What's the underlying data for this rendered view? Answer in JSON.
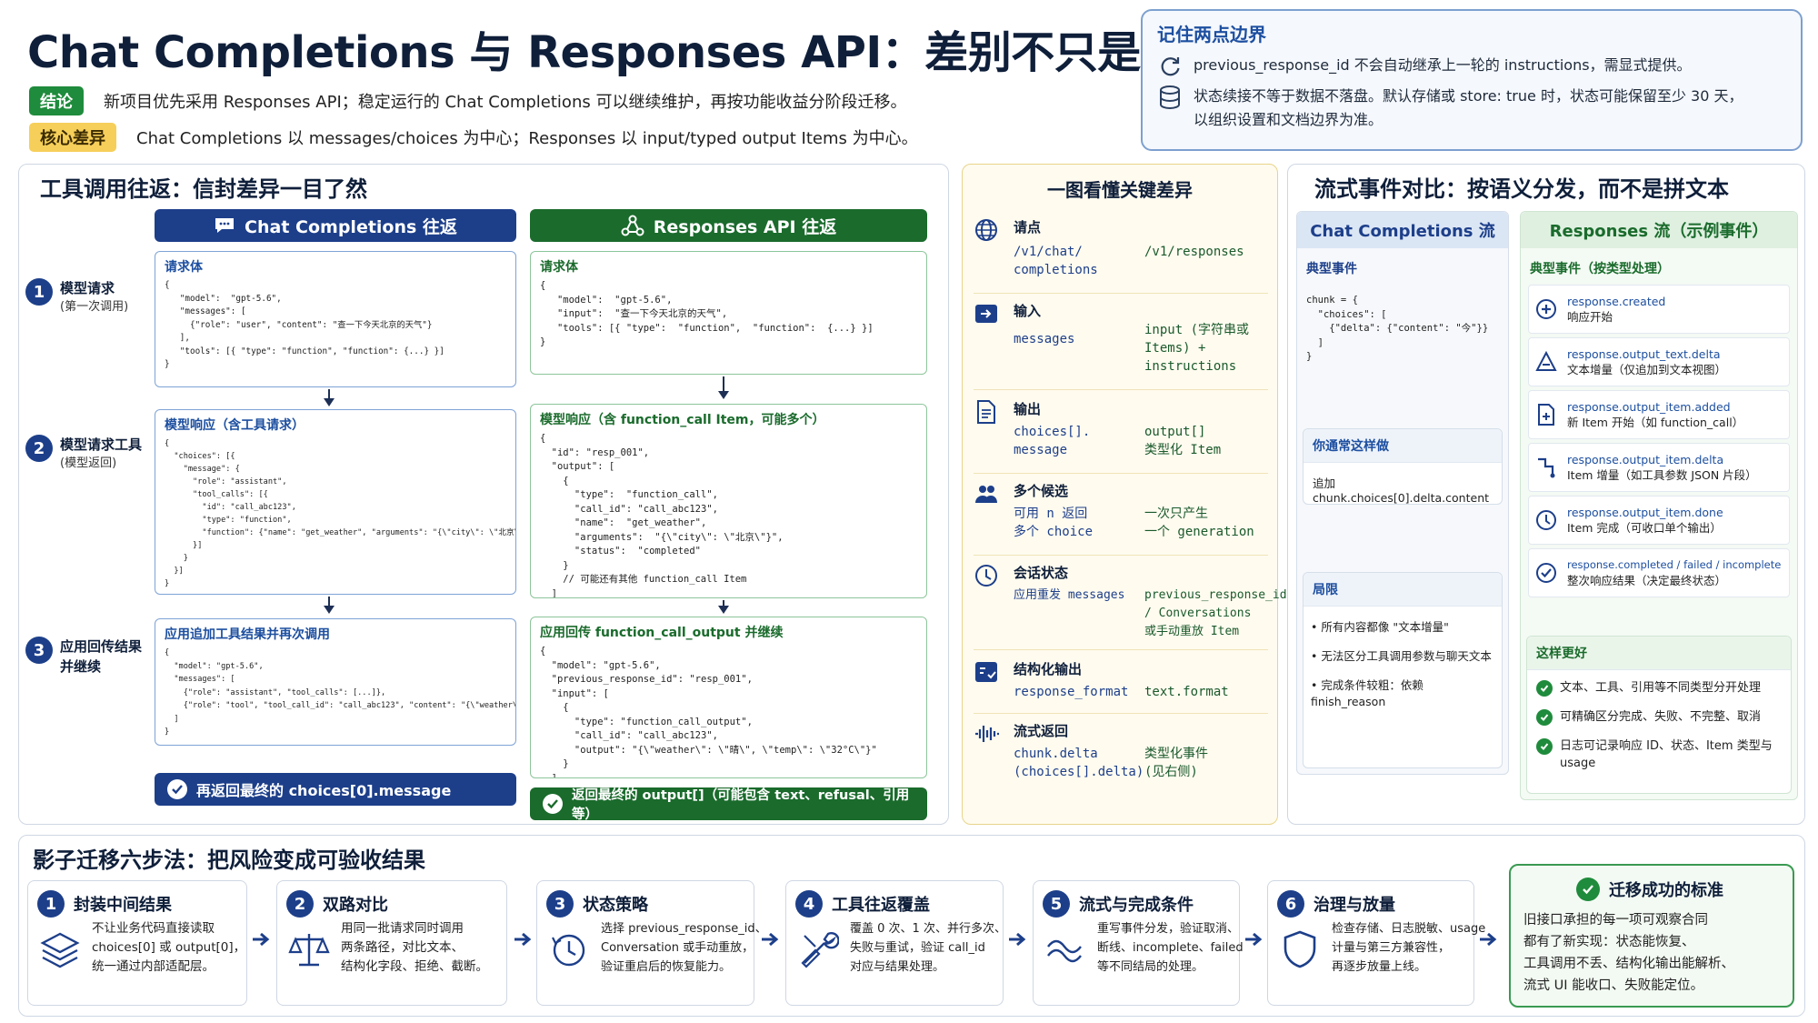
{
  "title": "Chat Completions 与 Responses API：差别不只是字段名",
  "conclusion": {
    "tag": "结论",
    "text": "新项目优先采用 Responses API；稳定运行的 Chat Completions 可以继续维护，再按功能收益分阶段迁移。"
  },
  "core_diff": {
    "tag": "核心差异",
    "text": "Chat Completions 以 messages/choices 为中心；Responses 以 input/typed output Items 为中心。"
  },
  "boundary": {
    "title": "记住两点边界",
    "item1": "previous_response_id 不会自动继承上一轮的 instructions，需显式提供。",
    "item2a": "状态续接不等于数据不落盘。默认存储或 store: true 时，状态可能保留至少 30 天，",
    "item2b": "以组织设置和文档边界为准。"
  },
  "tools_panel": {
    "title": "工具调用往返：信封差异一目了然",
    "chat_head": "Chat Completions 往返",
    "resp_head": "Responses API 往返",
    "steps": [
      {
        "num": "1",
        "label": "模型请求",
        "sub": "(第一次调用)"
      },
      {
        "num": "2",
        "label": "模型请求工具",
        "sub": "(模型返回)"
      },
      {
        "num": "3",
        "label": "应用回传结果",
        "sub": "并继续"
      }
    ],
    "chat_boxes": [
      {
        "title": "请求体",
        "code": "{\n   \"model\":  \"gpt-5.6\",\n   \"messages\": [\n     {\"role\": \"user\", \"content\": \"查一下今天北京的天气\"}\n   ],\n   \"tools\": [{ \"type\": \"function\", \"function\": {...} }]\n}"
      },
      {
        "title": "模型响应（含工具请求）",
        "code": "{\n  \"choices\": [{\n    \"message\": {\n      \"role\": \"assistant\",\n      \"tool_calls\": [{\n        \"id\": \"call_abc123\",\n        \"type\": \"function\",\n        \"function\": {\"name\": \"get_weather\", \"arguments\": \"{\\\"city\\\": \\\"北京\\\"}\"}\n      }]\n    }\n  }]\n}"
      },
      {
        "title": "应用追加工具结果并再次调用",
        "code": "{\n  \"model\": \"gpt-5.6\",\n  \"messages\": [\n    {\"role\": \"assistant\", \"tool_calls\": [...]},\n    {\"role\": \"tool\", \"tool_call_id\": \"call_abc123\", \"content\": \"{\\\"weather\\\": \\\"晴\\\"}\"}\n  ]\n}"
      }
    ],
    "resp_boxes": [
      {
        "title": "请求体",
        "code": "{\n   \"model\":  \"gpt-5.6\",\n   \"input\":  \"查一下今天北京的天气\",\n   \"tools\": [{ \"type\":  \"function\",  \"function\":  {...} }]\n}"
      },
      {
        "title": "模型响应（含 function_call Item，可能多个）",
        "code": "{\n  \"id\": \"resp_001\",\n  \"output\": [\n    {\n      \"type\":  \"function_call\",\n      \"call_id\": \"call_abc123\",\n      \"name\":  \"get_weather\",\n      \"arguments\":  \"{\\\"city\\\": \\\"北京\\\"}\",\n      \"status\":  \"completed\"\n    }\n    // 可能还有其他 function_call Item\n  ]\n}"
      },
      {
        "title": "应用回传 function_call_output 并继续",
        "code": "{\n  \"model\": \"gpt-5.6\",\n  \"previous_response_id\": \"resp_001\",\n  \"input\": [\n    {\n      \"type\": \"function_call_output\",\n      \"call_id\": \"call_abc123\",\n      \"output\": \"{\\\"weather\\\": \\\"晴\\\", \\\"temp\\\": \\\"32°C\\\"}\"\n    }\n  ]\n}"
      }
    ],
    "chat_result": "再返回最终的 choices[0].message",
    "resp_result": "返回最终的 output[]（可能包含 text、refusal、引用等）"
  },
  "key_diff": {
    "title": "一图看懂关键差异",
    "rows": [
      {
        "label": "请点",
        "chat": "/v1/chat/\ncompletions",
        "resp": "/v1/responses"
      },
      {
        "label": "输入",
        "chat": "messages",
        "resp": "input (字符串或\nItems) +\ninstructions"
      },
      {
        "label": "输出",
        "chat": "choices[].\nmessage",
        "resp": "output[]\n类型化 Item"
      },
      {
        "label": "多个候选",
        "chat": "可用 n 返回\n多个 choice",
        "resp": "一次只产生\n一个 generation"
      },
      {
        "label": "会话状态",
        "chat": "应用重发 messages",
        "resp": "previous_response_id\n/ Conversations\n或手动重放 Item"
      },
      {
        "label": "结构化输出",
        "chat": "response_format",
        "resp": "text.format"
      },
      {
        "label": "流式返回",
        "chat": "chunk.delta\n(choices[].delta)",
        "resp": "类型化事件\n(见右侧)"
      }
    ]
  },
  "stream": {
    "title": "流式事件对比：按语义分发，而不是拼文本",
    "chat_head": "Chat Completions 流",
    "chat_typical": "典型事件",
    "chat_code": "chunk = {\n  \"choices\": [\n    {\"delta\": {\"content\": \"今\"}}\n  ]\n}",
    "usual_title": "你通常这样做",
    "usual_text": "追加 chunk.choices[0].delta.content",
    "limit_title": "局限",
    "limits": [
      "所有内容都像 \"文本增量\"",
      "无法区分工具调用参数与聊天文本",
      "完成条件较粗：依赖 finish_reason"
    ],
    "resp_head": "Responses 流（示例事件）",
    "resp_typical": "典型事件（按类型处理）",
    "events": [
      {
        "name": "response.created",
        "desc": "响应开始",
        "icon": "plus-circle-icon"
      },
      {
        "name": "response.output_text.delta",
        "desc": "文本增量（仅追加到文本视图）",
        "icon": "text-delta-icon"
      },
      {
        "name": "response.output_item.added",
        "desc": "新 Item 开始（如 function_call）",
        "icon": "doc-add-icon"
      },
      {
        "name": "response.output_item.delta",
        "desc": "Item 增量（如工具参数 JSON 片段）",
        "icon": "connector-icon"
      },
      {
        "name": "response.output_item.done",
        "desc": "Item 完成（可收口单个输出）",
        "icon": "clock-icon"
      },
      {
        "name": "response.completed / failed / incomplete",
        "desc": "整次响应结果（决定最终状态）",
        "icon": "check-circle-icon"
      }
    ],
    "better_title": "这样更好",
    "better": [
      "文本、工具、引用等不同类型分开处理",
      "可精确区分完成、失败、不完整、取消",
      "日志可记录响应 ID、状态、Item 类型与 usage"
    ]
  },
  "migration": {
    "title": "影子迁移六步法：把风险变成可验收结果",
    "steps": [
      {
        "num": "1",
        "title": "封装中间结果",
        "desc": "不让业务代码直接读取\nchoices[0] 或 output[0]，\n统一通过内部适配层。"
      },
      {
        "num": "2",
        "title": "双路对比",
        "desc": "用同一批请求同时调用\n两条路径，对比文本、\n结构化字段、拒绝、截断。"
      },
      {
        "num": "3",
        "title": "状态策略",
        "desc": "选择 previous_response_id、\nConversation 或手动重放，\n验证重启后的恢复能力。"
      },
      {
        "num": "4",
        "title": "工具往返覆盖",
        "desc": "覆盖 0 次、1 次、并行多次、\n失败与重试，验证 call_id\n对应与结果处理。"
      },
      {
        "num": "5",
        "title": "流式与完成条件",
        "desc": "重写事件分发，验证取消、\n断线、incomplete、failed\n等不同结局的处理。"
      },
      {
        "num": "6",
        "title": "治理与放量",
        "desc": "检查存储、日志脱敏、usage\n计量与第三方兼容性，\n再逐步放量上线。"
      }
    ],
    "success_title": "迁移成功的标准",
    "success_text": "旧接口承担的每一项可观察合同\n都有了新实现：状态能恢复、\n工具调用不丢、结构化输出能解析、\n流式 UI 能收口、失败能定位。"
  },
  "colors": {
    "blue": "#1d3f8a",
    "green": "#1a6b2c",
    "accent_yellow": "#f6cf5a"
  }
}
